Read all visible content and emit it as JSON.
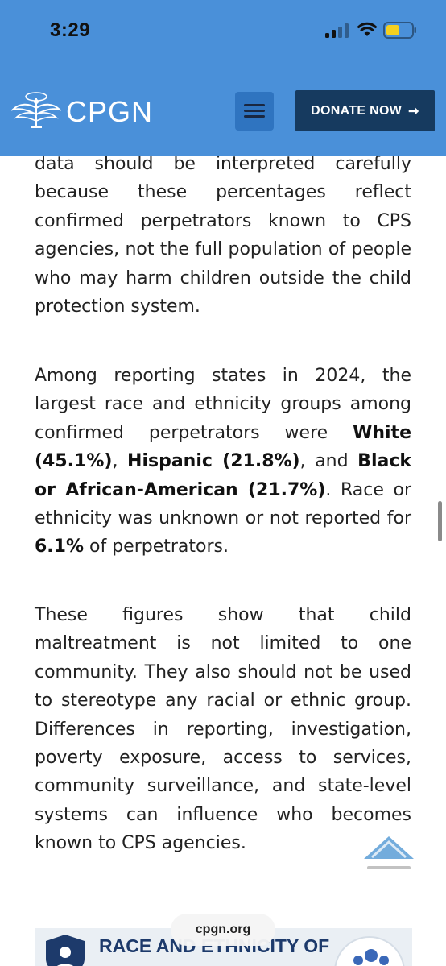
{
  "status_bar": {
    "time": "3:29"
  },
  "header": {
    "brand": "CPGN",
    "donate_label": "DONATE NOW",
    "donate_arrow": "➞",
    "colors": {
      "background": "#4a90d9",
      "donate": "#163a5f",
      "menu": "#2f74c0"
    }
  },
  "article": {
    "p0": "data should be interpreted carefully because these percentages reflect confirmed perpetrators known to CPS agencies, not the full population of people who may harm children outside the child protection system.",
    "p1": {
      "a": "Among reporting states in 2024, the largest race and ethnicity groups among confirmed perpetrators were ",
      "b1": "White (45.1%)",
      "c": ", ",
      "b2": "Hispanic (21.8%)",
      "d": ", and ",
      "b3": "Black or African-American (21.7%)",
      "e": ". Race or ethnicity was unknown or not reported for ",
      "b4": "6.1%",
      "f": " of perpetrators."
    },
    "p2": "These figures show that child maltreatment is not limited to one community. They also should not be used to stereotype any racial or ethnic group. Differences in reporting, investigation, poverty exposure, access to services, community surveillance, and state-level systems can influence who becomes known to CPS agencies."
  },
  "url_bar": {
    "domain": "cpgn.org"
  },
  "infographic": {
    "title": "RACE AND ETHNICITY OF"
  },
  "icons": [
    "cellular-signal-icon",
    "wifi-icon",
    "battery-icon",
    "logo-icon",
    "hamburger-menu-icon",
    "arrow-right-icon",
    "back-to-top-icon",
    "shield-icon",
    "people-icon"
  ]
}
